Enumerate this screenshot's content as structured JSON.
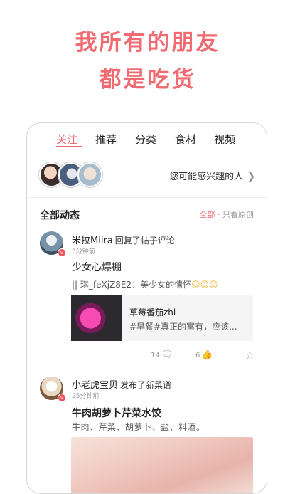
{
  "headline": {
    "line1": "我所有的朋友",
    "line2": "都是吃货"
  },
  "tabs": [
    {
      "label": "关注",
      "active": true
    },
    {
      "label": "推荐",
      "active": false
    },
    {
      "label": "分类",
      "active": false
    },
    {
      "label": "食材",
      "active": false
    },
    {
      "label": "视频",
      "active": false
    }
  ],
  "suggest": {
    "label": "您可能感兴趣的人",
    "icon": "chevron-right-icon"
  },
  "feed": {
    "section_title": "全部动态",
    "filter_all": "全部",
    "filter_sep": "·",
    "filter_original": "只看原创"
  },
  "posts": [
    {
      "user": "米拉Miira",
      "action": "回复了帖子评论",
      "time": "3分钟前",
      "text": "少女心爆棚",
      "quote": "|| 琪_feXjZ8E2：美少女的情怀",
      "quote_emoji": "😊😊😊",
      "card_title": "草莓番茄zhi",
      "card_sub": "#早餐#真正的富有，应该...",
      "comments": "14",
      "likes": "6"
    },
    {
      "user": "小老虎宝贝",
      "action": "发布了新菜谱",
      "time": "25分钟前",
      "recipe_title": "牛肉胡萝卜芹菜水饺",
      "ingredients": "牛肉、芹菜、胡萝卜、盐、料酒。"
    }
  ],
  "colors": {
    "accent": "#f16b72",
    "badge": "#f0525b"
  }
}
